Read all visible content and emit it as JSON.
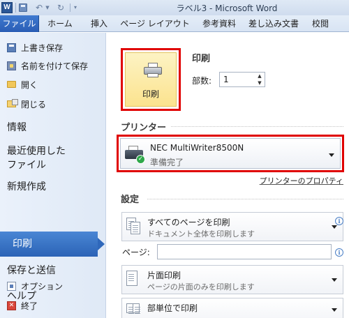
{
  "window": {
    "title": "ラベル3 - Microsoft Word",
    "app_icon_letter": "W",
    "qat": {
      "save_icon": "save-icon",
      "undo_icon": "undo-icon",
      "redo_icon": "redo-icon"
    }
  },
  "ribbon": {
    "tabs": [
      {
        "label": "ファイル",
        "active": true
      },
      {
        "label": "ホーム"
      },
      {
        "label": "挿入"
      },
      {
        "label": "ページ レイアウト"
      },
      {
        "label": "参考資料"
      },
      {
        "label": "差し込み文書"
      },
      {
        "label": "校閲"
      }
    ]
  },
  "backstage_nav": {
    "commands_top": [
      {
        "label": "上書き保存",
        "icon": "save-icon"
      },
      {
        "label": "名前を付けて保存",
        "icon": "save-as-icon"
      },
      {
        "label": "開く",
        "icon": "open-folder-icon"
      },
      {
        "label": "閉じる",
        "icon": "close-folder-icon"
      }
    ],
    "sections": [
      {
        "label": "情報"
      },
      {
        "label": "最近使用した\nファイル"
      },
      {
        "label": "新規作成"
      },
      {
        "label": "印刷",
        "active": true
      },
      {
        "label": "保存と送信"
      },
      {
        "label": "ヘルプ"
      }
    ],
    "commands_bottom": [
      {
        "label": "オプション",
        "icon": "options-icon"
      },
      {
        "label": "終了",
        "icon": "exit-icon"
      }
    ]
  },
  "print_panel": {
    "print_button_label": "印刷",
    "print_section_title": "印刷",
    "copies_label": "部数:",
    "copies_value": "1",
    "printer_section_title": "プリンター",
    "printer": {
      "name": "NEC MultiWriter8500N",
      "status": "準備完了"
    },
    "printer_properties_link": "プリンターのプロパティ",
    "settings_section_title": "設定",
    "settings": [
      {
        "title": "すべてのページを印刷",
        "subtitle": "ドキュメント全体を印刷します"
      },
      {
        "title": "片面印刷",
        "subtitle": "ページの片面のみを印刷します"
      },
      {
        "title": "部単位で印刷",
        "subtitle": ""
      }
    ],
    "pages_label": "ページ:",
    "pages_value": ""
  },
  "colors": {
    "highlight_border": "#e00000",
    "active_nav": "#2b63b6",
    "print_button_fill": "#fbe38e"
  }
}
